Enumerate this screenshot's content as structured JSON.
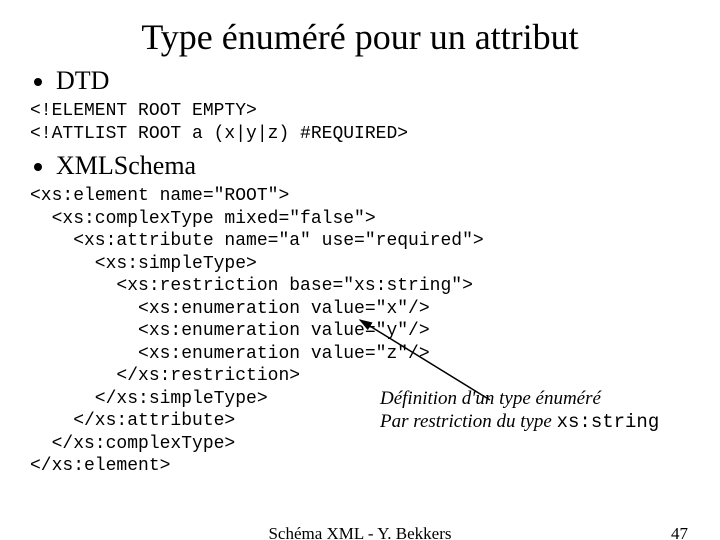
{
  "title": "Type énuméré pour un attribut",
  "bullets": {
    "dtd": "DTD",
    "xmlschema": "XMLSchema"
  },
  "dtd_code": "<!ELEMENT ROOT EMPTY>\n<!ATTLIST ROOT a (x|y|z) #REQUIRED>",
  "xsd_code_lines": [
    "<xs:element name=\"ROOT\">",
    "  <xs:complexType mixed=\"false\">",
    "    <xs:attribute name=\"a\" use=\"required\">",
    "      <xs:simpleType>",
    "        <xs:restriction base=\"xs:string\">",
    "          <xs:enumeration value=\"x\"/>",
    "          <xs:enumeration value=\"y\"/>",
    "          <xs:enumeration value=\"z\"/>",
    "        </xs:restriction>",
    "      </xs:simpleType>",
    "    </xs:attribute>",
    "  </xs:complexType>",
    "</xs:element>"
  ],
  "annotation": {
    "line1": "Définition d'un type énuméré",
    "line2_prefix": "Par restriction du type ",
    "line2_code": "xs:string"
  },
  "footer": {
    "center": "Schéma XML - Y. Bekkers",
    "page": "47"
  }
}
